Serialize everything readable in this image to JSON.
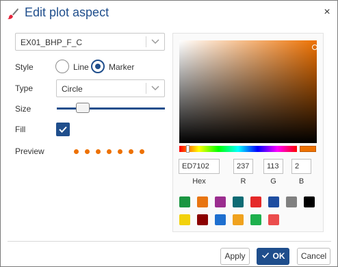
{
  "dialog": {
    "title": "Edit plot aspect",
    "close_label": "×"
  },
  "series_select": {
    "value": "EX01_BHP_F_C"
  },
  "style": {
    "label": "Style",
    "options": [
      "Line",
      "Marker"
    ],
    "selected": "Marker"
  },
  "type": {
    "label": "Type",
    "value": "Circle"
  },
  "size": {
    "label": "Size",
    "value_fraction": 0.2
  },
  "fill": {
    "label": "Fill",
    "checked": true
  },
  "preview": {
    "label": "Preview",
    "marker_color": "#ED7102",
    "marker_count": 7
  },
  "color_picker": {
    "hex": "ED7102",
    "r": "237",
    "g": "113",
    "b": "2",
    "labels": {
      "hex": "Hex",
      "r": "R",
      "g": "G",
      "b": "B"
    },
    "swatches": [
      "#1a9641",
      "#e87511",
      "#9b2d8f",
      "#0e6b74",
      "#e52929",
      "#1e4da0",
      "#808080",
      "#000000",
      "#f2d10b",
      "#8b0000",
      "#1e6fcf",
      "#f0a21e",
      "#1eb04d",
      "#eb4c4c"
    ]
  },
  "buttons": {
    "apply": "Apply",
    "ok": "OK",
    "cancel": "Cancel"
  }
}
